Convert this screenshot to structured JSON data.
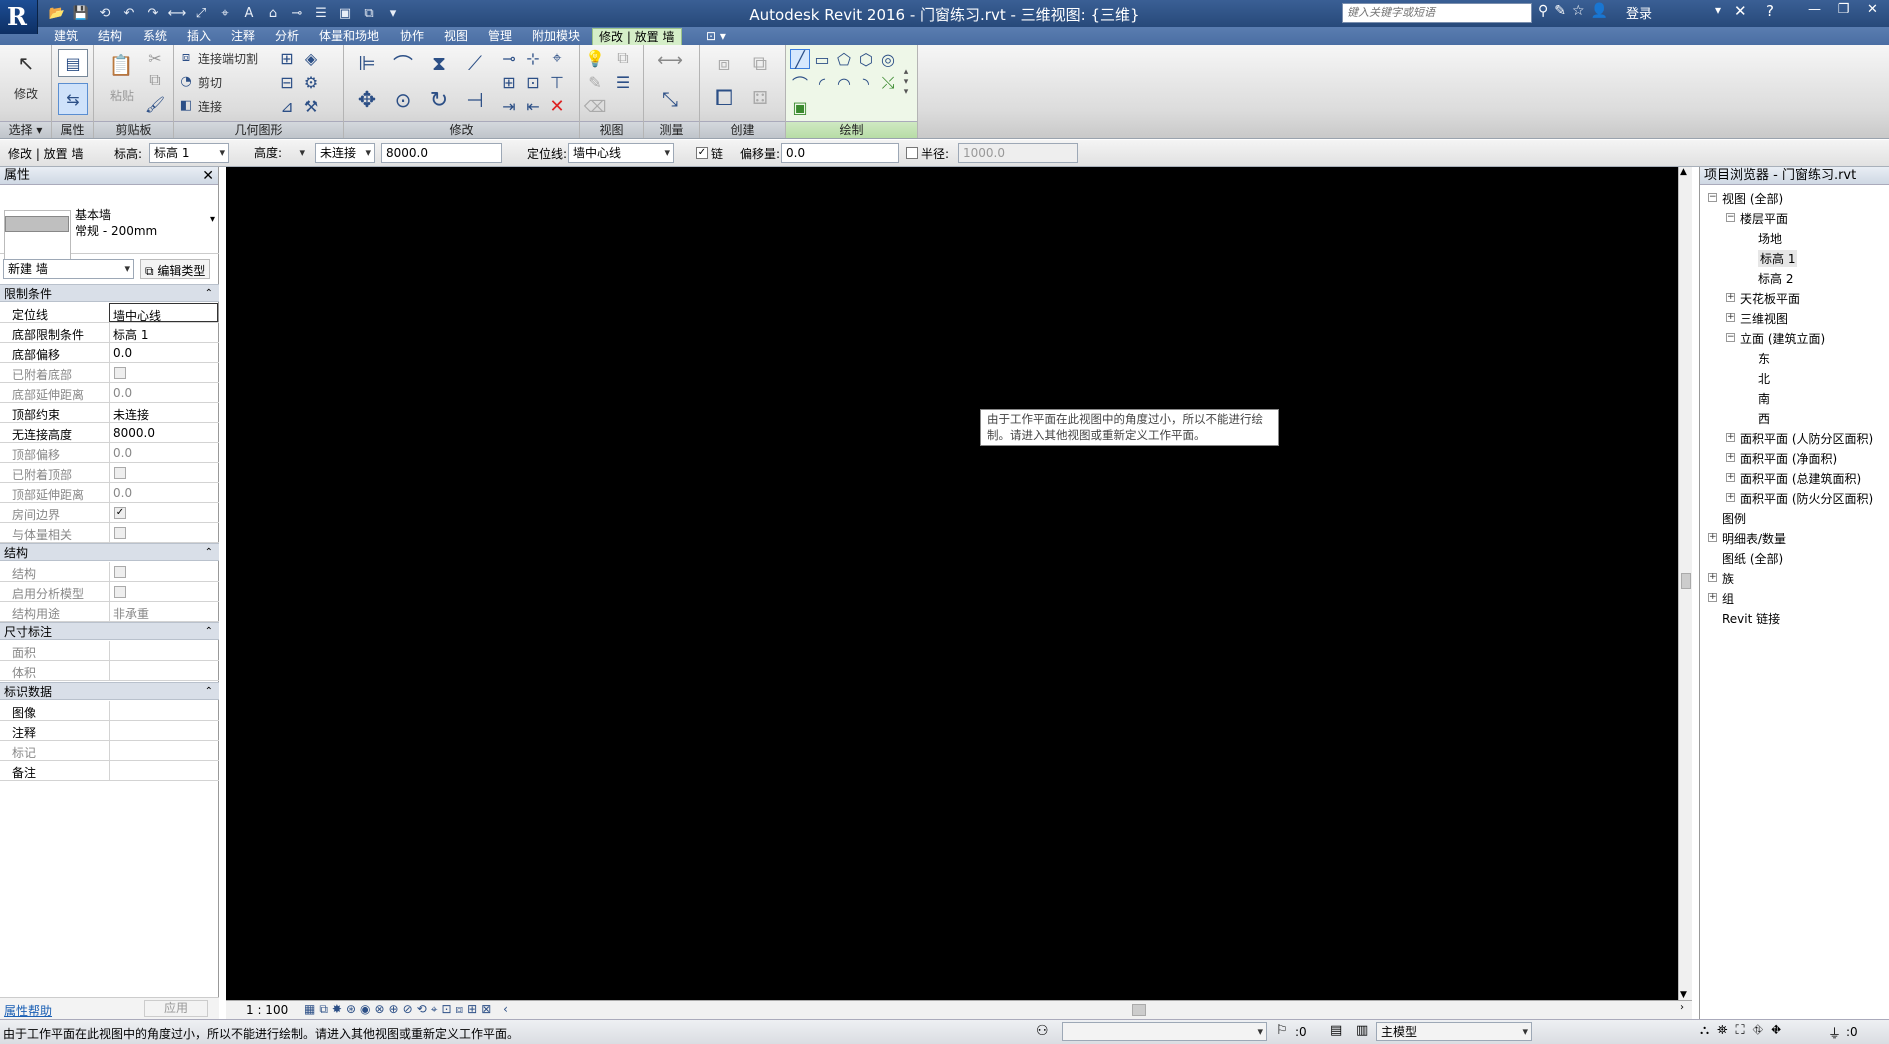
{
  "window": {
    "title": "Autodesk Revit 2016 -    门窗练习.rvt - 三维视图: {三维}",
    "login": "登录"
  },
  "search": {
    "placeholder": "键入关键字或短语"
  },
  "tabs": [
    "建筑",
    "结构",
    "系统",
    "插入",
    "注释",
    "分析",
    "体量和场地",
    "协作",
    "视图",
    "管理",
    "附加模块",
    "修改 | 放置 墙"
  ],
  "ribbon": {
    "panels": [
      "选择",
      "属性",
      "剪贴板",
      "几何图形",
      "修改",
      "视图",
      "测量",
      "创建",
      "绘制"
    ],
    "modify_label": "修改",
    "paste_label": "粘贴",
    "join_cut_label": "连接端切割",
    "cut_label": "剪切",
    "join_label": "连接"
  },
  "options_bar": {
    "context": "修改 | 放置 墙",
    "level_label": "标高:",
    "level_value": "标高 1",
    "height_mode": "高度:",
    "height_constraint": "未连接",
    "height_value": "8000.0",
    "locline_label": "定位线:",
    "locline_value": "墙中心线",
    "chain_label": "链",
    "offset_label": "偏移量:",
    "offset_value": "0.0",
    "radius_label": "半径:",
    "radius_value": "1000.0"
  },
  "properties": {
    "title": "属性",
    "type_family": "基本墙",
    "type_name": "常规 - 200mm",
    "instance_selector": "新建 墙",
    "edit_type": "编辑类型",
    "groups": [
      {
        "name": "限制条件",
        "rows": [
          {
            "k": "定位线",
            "v": "墙中心线"
          },
          {
            "k": "底部限制条件",
            "v": "标高 1"
          },
          {
            "k": "底部偏移",
            "v": "0.0"
          },
          {
            "k": "已附着底部",
            "v": ""
          },
          {
            "k": "底部延伸距离",
            "v": "0.0"
          },
          {
            "k": "顶部约束",
            "v": "未连接"
          },
          {
            "k": "无连接高度",
            "v": "8000.0"
          },
          {
            "k": "顶部偏移",
            "v": "0.0"
          },
          {
            "k": "已附着顶部",
            "v": ""
          },
          {
            "k": "顶部延伸距离",
            "v": "0.0"
          },
          {
            "k": "房间边界",
            "v": ""
          },
          {
            "k": "与体量相关",
            "v": ""
          }
        ]
      },
      {
        "name": "结构",
        "rows": [
          {
            "k": "结构",
            "v": ""
          },
          {
            "k": "启用分析模型",
            "v": ""
          },
          {
            "k": "结构用途",
            "v": "非承重"
          }
        ]
      },
      {
        "name": "尺寸标注",
        "rows": [
          {
            "k": "面积",
            "v": ""
          },
          {
            "k": "体积",
            "v": ""
          }
        ]
      },
      {
        "name": "标识数据",
        "rows": [
          {
            "k": "图像",
            "v": ""
          },
          {
            "k": "注释",
            "v": ""
          },
          {
            "k": "标记",
            "v": ""
          },
          {
            "k": "备注",
            "v": ""
          }
        ]
      }
    ],
    "help_link": "属性帮助",
    "apply": "应用"
  },
  "canvas": {
    "tooltip_line1": "由于工作平面在此视图中的角度过小，所以不能进行绘",
    "tooltip_line2": "制。请进入其他视图或重新定义工作平面。",
    "scale": "1 : 100"
  },
  "browser": {
    "title": "项目浏览器 - 门窗练习.rvt",
    "nodes": [
      {
        "label": "视图 (全部)",
        "level": 0,
        "exp": "−"
      },
      {
        "label": "楼层平面",
        "level": 1,
        "exp": "−"
      },
      {
        "label": "场地",
        "level": 2,
        "exp": ""
      },
      {
        "label": "标高 1",
        "level": 2,
        "exp": ""
      },
      {
        "label": "标高 2",
        "level": 2,
        "exp": ""
      },
      {
        "label": "天花板平面",
        "level": 1,
        "exp": "+"
      },
      {
        "label": "三维视图",
        "level": 1,
        "exp": "+"
      },
      {
        "label": "立面 (建筑立面)",
        "level": 1,
        "exp": "−"
      },
      {
        "label": "东",
        "level": 2,
        "exp": ""
      },
      {
        "label": "北",
        "level": 2,
        "exp": ""
      },
      {
        "label": "南",
        "level": 2,
        "exp": ""
      },
      {
        "label": "西",
        "level": 2,
        "exp": ""
      },
      {
        "label": "面积平面 (人防分区面积)",
        "level": 1,
        "exp": "+"
      },
      {
        "label": "面积平面 (净面积)",
        "level": 1,
        "exp": "+"
      },
      {
        "label": "面积平面 (总建筑面积)",
        "level": 1,
        "exp": "+"
      },
      {
        "label": "面积平面 (防火分区面积)",
        "level": 1,
        "exp": "+"
      },
      {
        "label": "图例",
        "level": 0,
        "exp": ""
      },
      {
        "label": "明细表/数量",
        "level": 0,
        "exp": "+"
      },
      {
        "label": "图纸 (全部)",
        "level": 0,
        "exp": ""
      },
      {
        "label": "族",
        "level": 0,
        "exp": "+"
      },
      {
        "label": "组",
        "level": 0,
        "exp": "+"
      },
      {
        "label": "Revit 链接",
        "level": 0,
        "exp": ""
      }
    ]
  },
  "status": {
    "message": "由于工作平面在此视图中的角度过小，所以不能进行绘制。请进入其他视图或重新定义工作平面。",
    "count": ":0",
    "model": "主模型",
    "filter": ":0"
  }
}
